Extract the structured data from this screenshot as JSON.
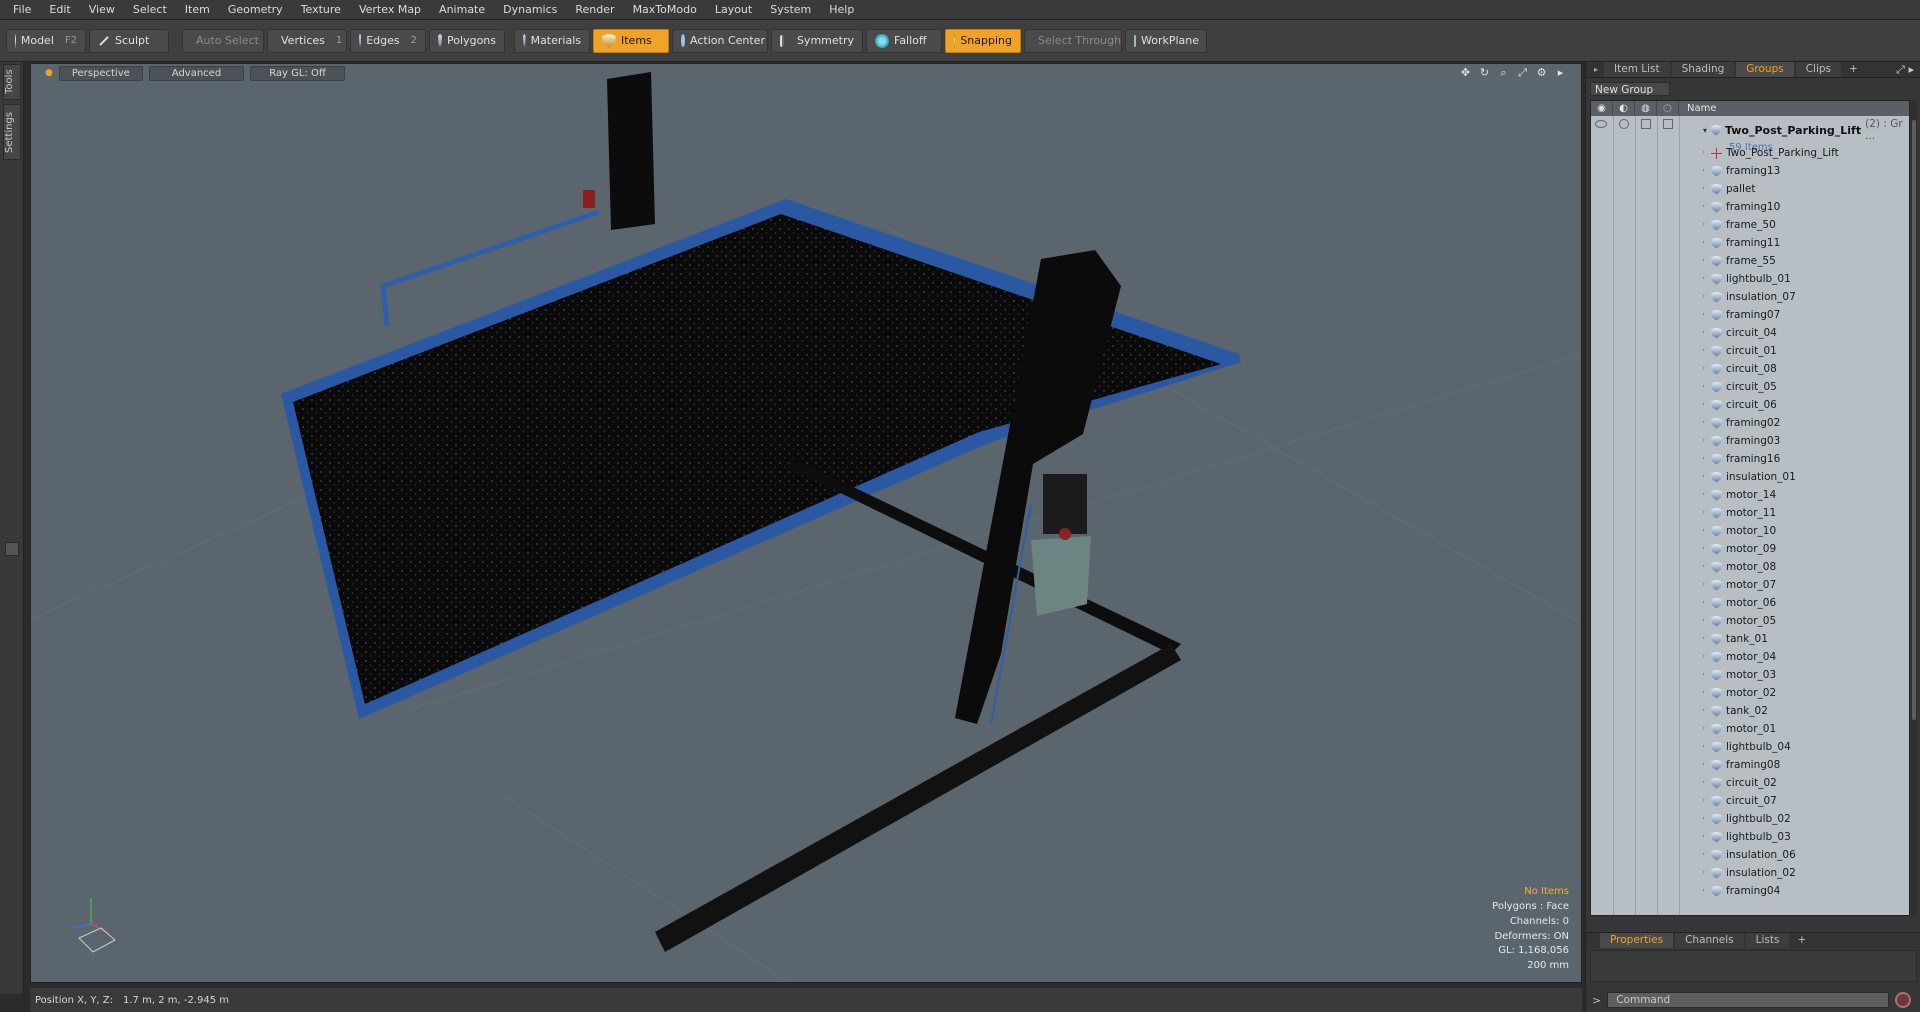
{
  "menu": [
    "File",
    "Edit",
    "View",
    "Select",
    "Item",
    "Geometry",
    "Texture",
    "Vertex Map",
    "Animate",
    "Dynamics",
    "Render",
    "MaxToModo",
    "Layout",
    "System",
    "Help"
  ],
  "toolbar": {
    "model": "Model",
    "model_key": "F2",
    "sculpt": "Sculpt",
    "auto_select": "Auto Select",
    "vertices": "Vertices",
    "vertices_key": "1",
    "edges": "Edges",
    "edges_key": "2",
    "polygons": "Polygons",
    "materials": "Materials",
    "items": "Items",
    "action_center": "Action Center",
    "symmetry": "Symmetry",
    "falloff": "Falloff",
    "snapping": "Snapping",
    "select_through": "Select Through",
    "workplane": "WorkPlane"
  },
  "left_tabs": [
    "Tools",
    "Settings"
  ],
  "viewport": {
    "view_mode": "Perspective",
    "shading": "Advanced",
    "raygl": "Ray GL: Off",
    "info": {
      "selection": "No Items",
      "polygons": "Polygons : Face",
      "channels": "Channels: 0",
      "deformers": "Deformers: ON",
      "gl": "GL: 1,168,056",
      "grid": "200 mm"
    }
  },
  "status": {
    "position_label": "Position X, Y, Z:",
    "position_value": "1.7 m, 2 m, -2.945 m"
  },
  "panel": {
    "tabs": [
      "Item List",
      "Shading",
      "Groups",
      "Clips"
    ],
    "active_tab": "Groups",
    "new_group": "New Group",
    "name_header": "Name",
    "root_title": "Two_Post_Parking_Lift",
    "root_suffix": "(2) : Gr ...",
    "root_sub": "59 Items",
    "locator": "Two_Post_Parking_Lift",
    "items": [
      "framing13",
      "pallet",
      "framing10",
      "frame_50",
      "framing11",
      "frame_55",
      "lightbulb_01",
      "insulation_07",
      "framing07",
      "circuit_04",
      "circuit_01",
      "circuit_08",
      "circuit_05",
      "circuit_06",
      "framing02",
      "framing03",
      "framing16",
      "insulation_01",
      "motor_14",
      "motor_11",
      "motor_10",
      "motor_09",
      "motor_08",
      "motor_07",
      "motor_06",
      "motor_05",
      "tank_01",
      "motor_04",
      "motor_03",
      "motor_02",
      "tank_02",
      "motor_01",
      "lightbulb_04",
      "framing08",
      "circuit_02",
      "circuit_07",
      "lightbulb_02",
      "lightbulb_03",
      "insulation_06",
      "insulation_02",
      "framing04"
    ],
    "bottom_tabs": [
      "Properties",
      "Channels",
      "Lists"
    ],
    "bottom_active": "Properties",
    "command_placeholder": "Command"
  },
  "colors": {
    "accent": "#f0a326",
    "viewport_bg": "#5a656d",
    "lift_blue": "#2f5fa8"
  }
}
